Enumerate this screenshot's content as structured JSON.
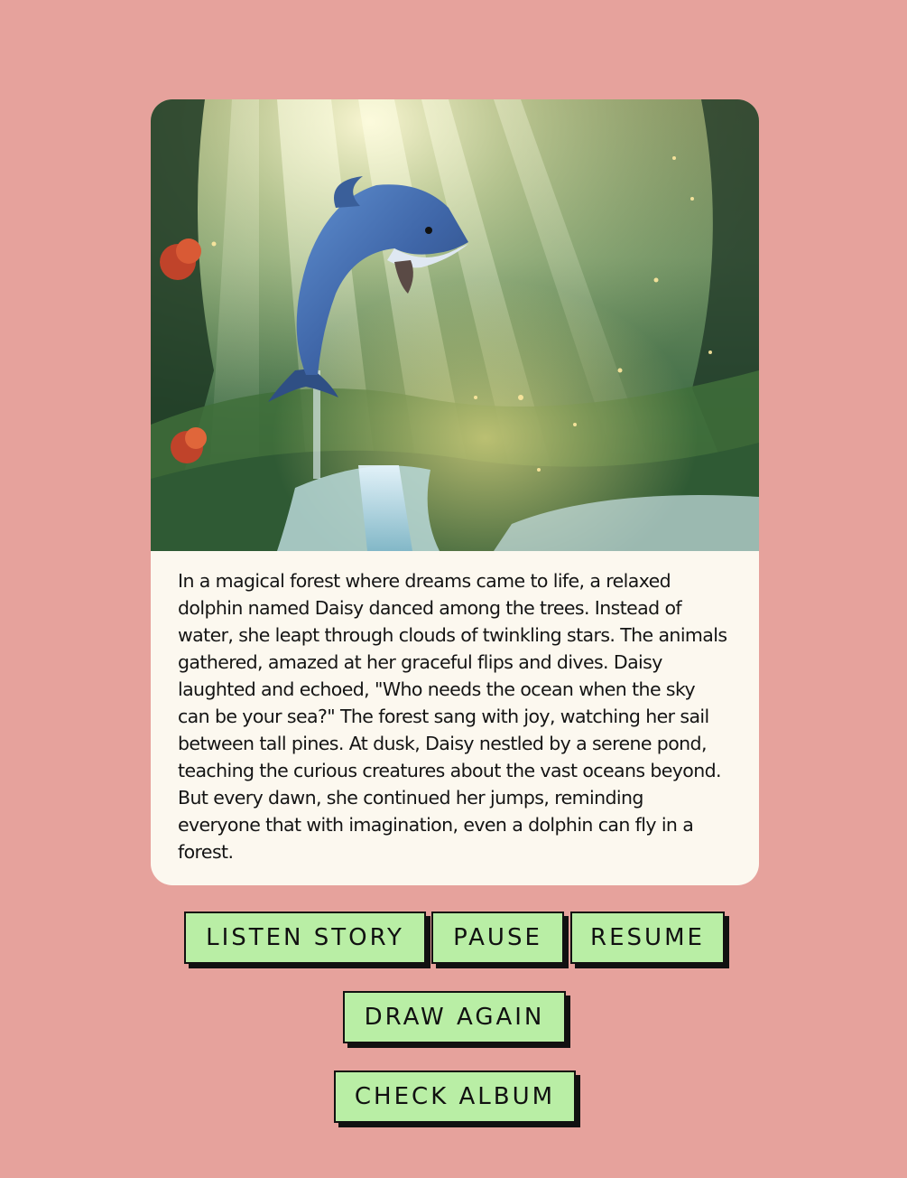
{
  "card": {
    "image_alt": "Dolphin leaping above a waterfall in a sunlit forest",
    "story": "In a magical forest where dreams came to life, a relaxed dolphin named Daisy danced among the trees. Instead of water, she leapt through clouds of twinkling stars. The animals gathered, amazed at her graceful flips and dives. Daisy laughted and echoed, \"Who needs the ocean when the sky can be your sea?\" The forest sang with joy, watching her sail between tall pines. At dusk, Daisy nestled by a serene pond, teaching the curious creatures about the vast oceans beyond. But every dawn, she continued her jumps, reminding everyone that with imagination, even a dolphin can fly in a forest."
  },
  "controls": {
    "listen_label": "LISTEN STORY",
    "pause_label": "PAUSE",
    "resume_label": "RESUME",
    "draw_again_label": "DRAW AGAIN",
    "album_label": "CHECK ALBUM"
  },
  "colors": {
    "page_background": "#e6a29c",
    "card_background": "#fcf8ef",
    "button_fill": "#b9eea5",
    "button_border": "#111111"
  }
}
